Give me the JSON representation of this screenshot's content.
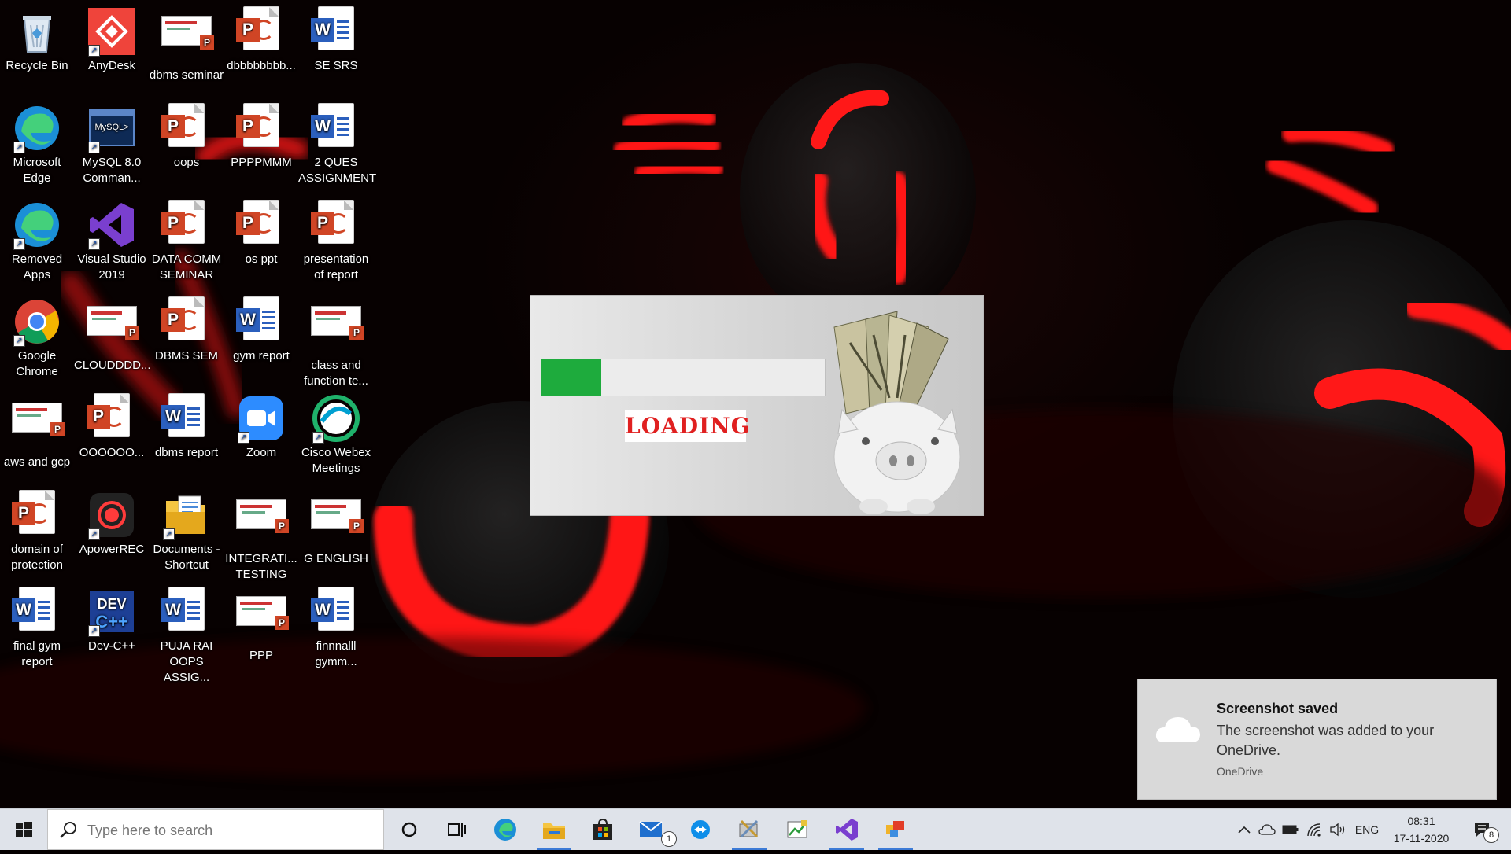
{
  "desktop": {
    "icons": [
      {
        "label": "Recycle Bin",
        "icon": "recycle-bin-icon"
      },
      {
        "label": "AnyDesk",
        "icon": "anydesk-icon"
      },
      {
        "label": "dbms seminar",
        "icon": "presentation-thumbnail-icon"
      },
      {
        "label": "dbbbbbbbb...",
        "icon": "powerpoint-file-icon"
      },
      {
        "label": "SE SRS",
        "icon": "word-file-icon"
      },
      {
        "label": "Microsoft Edge",
        "icon": "edge-icon"
      },
      {
        "label": "MySQL 8.0 Comman...",
        "icon": "mysql-icon"
      },
      {
        "label": "oops",
        "icon": "powerpoint-file-icon"
      },
      {
        "label": "PPPPMMM",
        "icon": "powerpoint-file-icon"
      },
      {
        "label": "2 QUES ASSIGNMENT",
        "icon": "word-file-icon"
      },
      {
        "label": "Removed Apps",
        "icon": "edge-icon"
      },
      {
        "label": "Visual Studio 2019",
        "icon": "visual-studio-icon"
      },
      {
        "label": "DATA COMM SEMINAR",
        "icon": "powerpoint-file-icon"
      },
      {
        "label": "os ppt",
        "icon": "powerpoint-file-icon"
      },
      {
        "label": "presentation of report",
        "icon": "powerpoint-file-icon"
      },
      {
        "label": "Google Chrome",
        "icon": "chrome-icon"
      },
      {
        "label": "CLOUDDDD...",
        "icon": "presentation-thumbnail-icon"
      },
      {
        "label": "DBMS SEM",
        "icon": "powerpoint-file-icon"
      },
      {
        "label": "gym report",
        "icon": "word-file-icon"
      },
      {
        "label": "class and function te...",
        "icon": "presentation-thumbnail-icon"
      },
      {
        "label": "aws and gcp",
        "icon": "presentation-thumbnail-icon"
      },
      {
        "label": "OOOOOO...",
        "icon": "powerpoint-file-icon"
      },
      {
        "label": "dbms report",
        "icon": "word-file-icon"
      },
      {
        "label": "Zoom",
        "icon": "zoom-icon"
      },
      {
        "label": "Cisco Webex Meetings",
        "icon": "webex-icon"
      },
      {
        "label": "domain of protection",
        "icon": "powerpoint-file-icon"
      },
      {
        "label": "ApowerREC",
        "icon": "apowerrec-icon"
      },
      {
        "label": "Documents - Shortcut",
        "icon": "folder-icon"
      },
      {
        "label": "INTEGRATI... TESTING",
        "icon": "presentation-thumbnail-icon"
      },
      {
        "label": "G ENGLISH",
        "icon": "presentation-thumbnail-icon"
      },
      {
        "label": "final gym report",
        "icon": "word-file-icon"
      },
      {
        "label": "Dev-C++",
        "icon": "devcpp-icon"
      },
      {
        "label": "PUJA RAI OOPS ASSIG...",
        "icon": "word-file-icon"
      },
      {
        "label": "PPP",
        "icon": "presentation-thumbnail-icon"
      },
      {
        "label": "finnnalll gymm...",
        "icon": "word-file-icon"
      }
    ]
  },
  "loader": {
    "text": "LOADING",
    "progress": 0.21,
    "colors": {
      "bar": "#1eab3d",
      "text": "#e02020"
    }
  },
  "toast": {
    "title": "Screenshot saved",
    "body": "The screenshot was added to your OneDrive.",
    "source": "OneDrive",
    "icon": "cloud-icon"
  },
  "taskbar": {
    "search_placeholder": "Type here to search",
    "apps": [
      {
        "name": "cortana-icon",
        "active": false
      },
      {
        "name": "task-view-icon",
        "active": false
      },
      {
        "name": "edge-icon",
        "active": false
      },
      {
        "name": "file-explorer-icon",
        "active": true
      },
      {
        "name": "store-icon",
        "active": false
      },
      {
        "name": "mail-icon",
        "active": false,
        "badge": "1"
      },
      {
        "name": "teamviewer-icon",
        "active": false
      },
      {
        "name": "control-panel-icon",
        "active": true
      },
      {
        "name": "spreadsheet-app-icon",
        "active": false
      },
      {
        "name": "visual-studio-icon",
        "active": true
      },
      {
        "name": "windows-app-icon",
        "active": true
      }
    ],
    "tray": {
      "language": "ENG",
      "time": "08:31",
      "date": "17-11-2020",
      "notification_count": "8"
    }
  }
}
